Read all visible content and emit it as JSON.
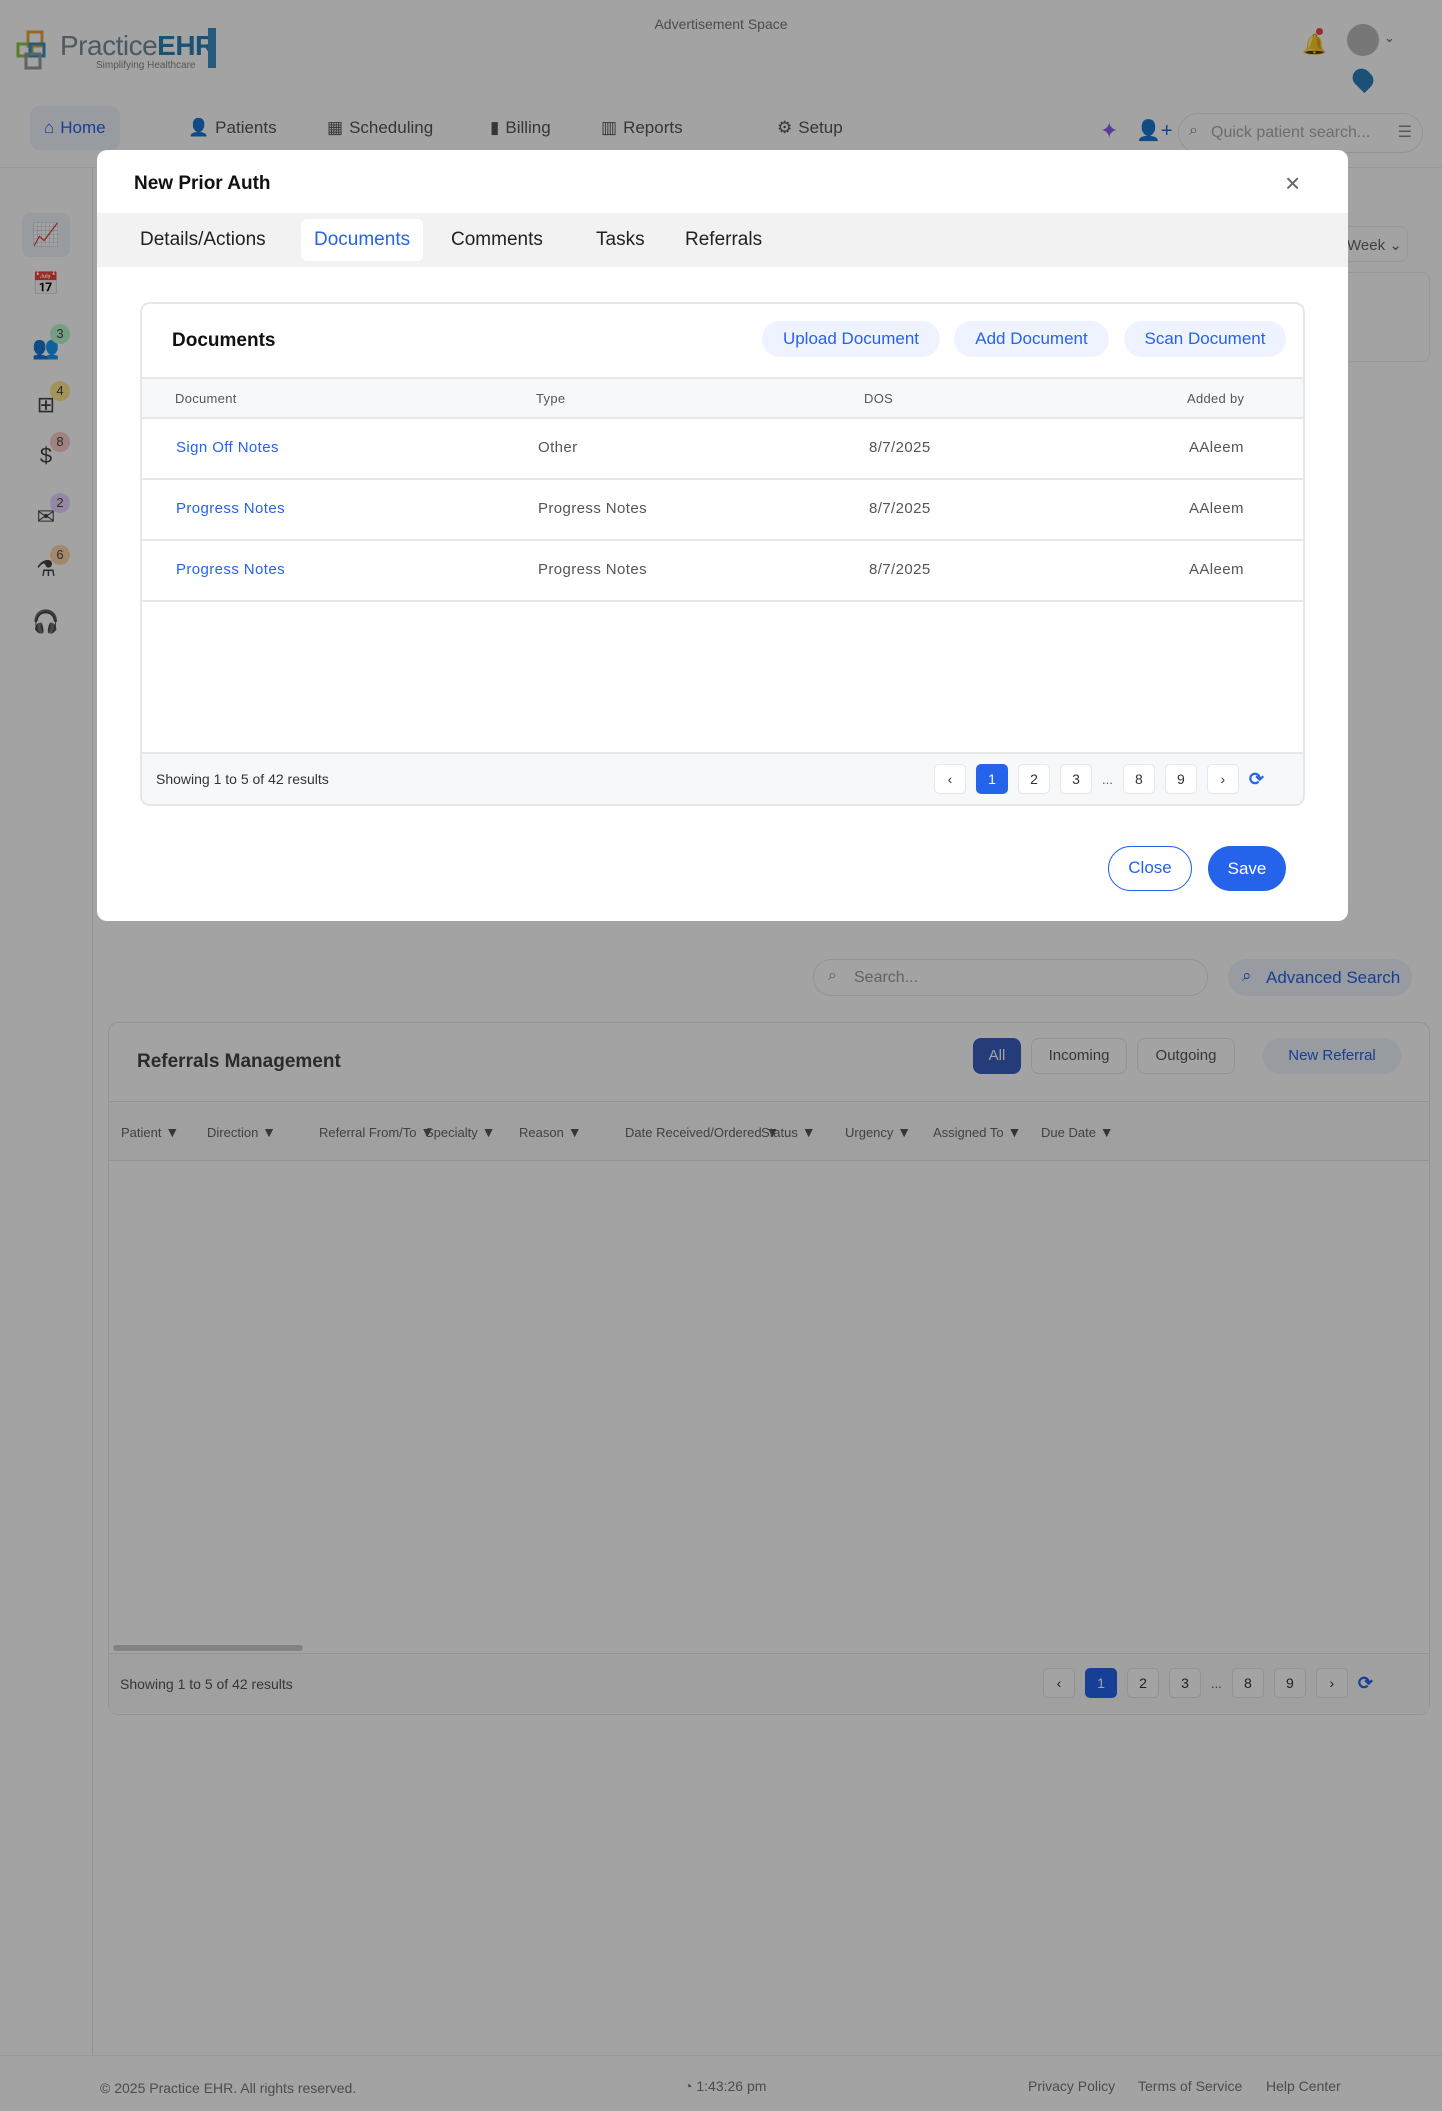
{
  "header": {
    "logo_text": "PracticeEHR",
    "logo_tagline": "Simplifying Healthcare",
    "ad": "Advertisement Space",
    "search_placeholder": "Quick patient search..."
  },
  "nav": [
    {
      "label": "Home",
      "icon": "home-icon"
    },
    {
      "label": "Patients",
      "icon": "patient-icon"
    },
    {
      "label": "Scheduling",
      "icon": "calendar-icon"
    },
    {
      "label": "Billing",
      "icon": "billing-icon"
    },
    {
      "label": "Reports",
      "icon": "reports-icon"
    },
    {
      "label": "Setup",
      "icon": "gear-icon"
    }
  ],
  "sidebar": [
    {
      "icon": "chart-icon"
    },
    {
      "icon": "calendar-check-icon"
    },
    {
      "icon": "users-icon",
      "badge": "3",
      "badge_color": "#bbf7d0"
    },
    {
      "icon": "add-document-icon",
      "badge": "4",
      "badge_color": "#fde68a"
    },
    {
      "icon": "invoice-icon",
      "badge": "8",
      "badge_color": "#fecaca"
    },
    {
      "icon": "mail-icon",
      "badge": "2",
      "badge_color": "#e9d5ff"
    },
    {
      "icon": "lab-flask-icon",
      "badge": "6",
      "badge_color": "#fed7aa"
    },
    {
      "icon": "headset-icon"
    }
  ],
  "background": {
    "week_select": "Week",
    "search_placeholder": "Search...",
    "advanced_search": "Advanced Search",
    "referrals": {
      "title": "Referrals Management",
      "filters": [
        "All",
        "Incoming",
        "Outgoing"
      ],
      "active_filter": "All",
      "new_button": "New Referral",
      "columns": [
        "Patient",
        "Direction",
        "Referral From/To",
        "Specialty",
        "Reason",
        "Date Received/Ordered",
        "Status",
        "Urgency",
        "Assigned To",
        "Due Date"
      ],
      "showing": "Showing 1 to 5 of 42 results",
      "pages": [
        "1",
        "2",
        "3",
        "...",
        "8",
        "9"
      ],
      "current_page": "1"
    }
  },
  "footer": {
    "copyright": "© 2025 Practice EHR. All rights reserved.",
    "time": "1:43:26 pm",
    "links": [
      "Privacy Policy",
      "Terms of Service",
      "Help Center"
    ]
  },
  "modal": {
    "title": "New Prior Auth",
    "tabs": [
      "Details/Actions",
      "Documents",
      "Comments",
      "Tasks",
      "Referrals"
    ],
    "active_tab": "Documents",
    "documents": {
      "title": "Documents",
      "buttons": [
        "Upload Document",
        "Add Document",
        "Scan Document"
      ],
      "columns": [
        "Document",
        "Type",
        "DOS",
        "Added by"
      ],
      "rows": [
        {
          "document": "Sign Off Notes",
          "type": "Other",
          "dos": "8/7/2025",
          "added_by": "AAleem"
        },
        {
          "document": "Progress Notes",
          "type": "Progress Notes",
          "dos": "8/7/2025",
          "added_by": "AAleem"
        },
        {
          "document": "Progress Notes",
          "type": "Progress Notes",
          "dos": "8/7/2025",
          "added_by": "AAleem"
        }
      ],
      "showing": "Showing 1 to 5 of 42 results",
      "pages": [
        "1",
        "2",
        "3",
        "...",
        "8",
        "9"
      ],
      "current_page": "1"
    },
    "close_label": "Close",
    "save_label": "Save"
  },
  "colors": {
    "accent": "#2563eb",
    "overlay": "rgba(0,0,0,0.36)"
  }
}
